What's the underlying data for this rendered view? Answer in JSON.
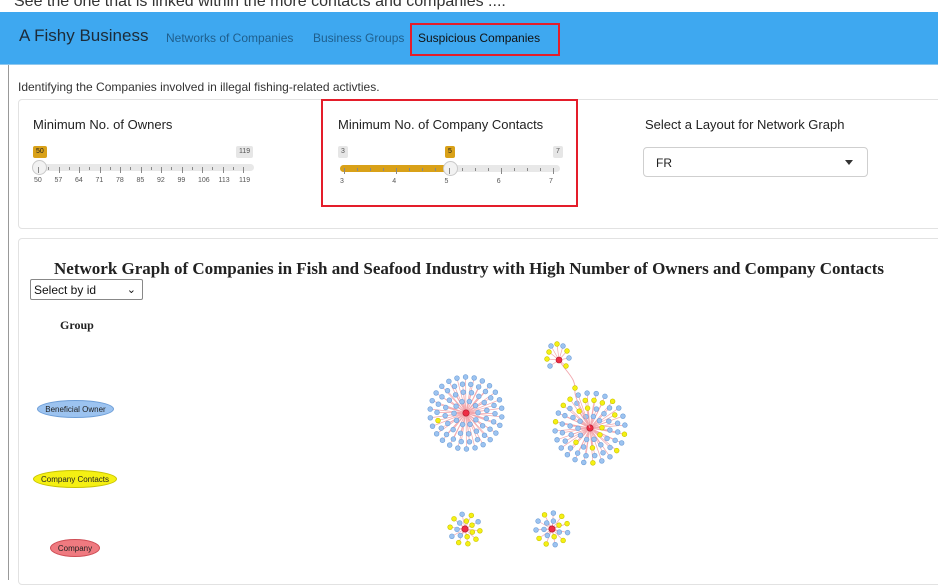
{
  "top_strip": {
    "text": "See the one that is linked within the more contacts and companies ...."
  },
  "navbar": {
    "brand": "A Fishy Business",
    "links": [
      {
        "label": "Networks of Companies",
        "active": false
      },
      {
        "label": "Business Groups",
        "active": false
      },
      {
        "label": "Suspicious Companies",
        "active": true
      }
    ],
    "bg_color": "#3ea8f0"
  },
  "intro_text": "Identifying the Companies involved in illegal fishing-related activties.",
  "controls": {
    "owners_slider": {
      "label": "Minimum No. of Owners",
      "min": 50,
      "max": 119,
      "value": 50,
      "ticks": [
        "50",
        "57",
        "64",
        "71",
        "78",
        "85",
        "92",
        "99",
        "106",
        "113",
        "119"
      ],
      "min_badge": "50",
      "max_badge": "119"
    },
    "contacts_slider": {
      "label": "Minimum No. of Company Contacts",
      "min": 3,
      "max": 7,
      "value": 5,
      "ticks": [
        "3",
        "4",
        "5",
        "6",
        "7"
      ],
      "min_badge": "3",
      "max_badge": "7",
      "value_badge": "5"
    },
    "layout_select": {
      "label": "Select a Layout for Network Graph",
      "value": "FR"
    },
    "accent_color": "#d9a118"
  },
  "graph": {
    "title": "Network Graph of Companies in Fish and Seafood Industry with High Number of Owners and Company Contacts",
    "id_select": "Select by id",
    "legend_title": "Group",
    "legend": [
      {
        "label": "Beneficial Owner",
        "color": "#9cc3f0",
        "border": "#6f9fd8"
      },
      {
        "label": "Company Contacts",
        "color": "#f5f013",
        "border": "#c9c400"
      },
      {
        "label": "Company",
        "color": "#ef7a80",
        "border": "#cf4d55"
      }
    ],
    "edge_color": "#f2a7ad"
  }
}
